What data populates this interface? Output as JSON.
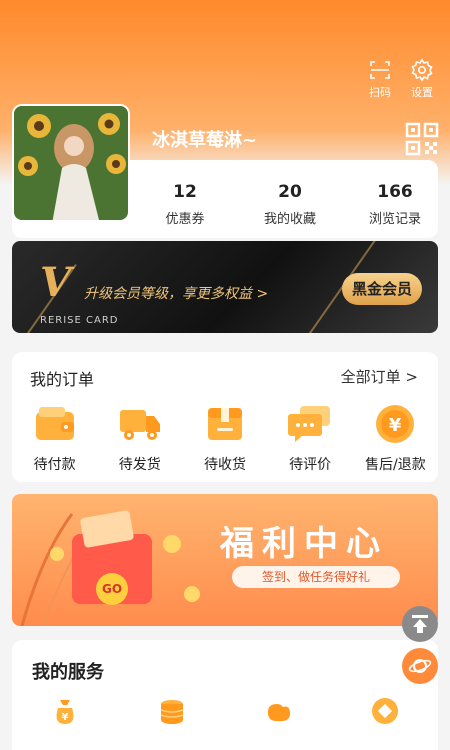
{
  "header": {
    "scan_label": "扫码",
    "settings_label": "设置"
  },
  "profile": {
    "username": "冰淇草莓淋~",
    "stats": [
      {
        "value": "12",
        "label": "优惠券"
      },
      {
        "value": "20",
        "label": "我的收藏"
      },
      {
        "value": "166",
        "label": "浏览记录"
      }
    ]
  },
  "vip": {
    "letter": "V",
    "text": "升级会员等级，享更多权益 >",
    "sub": "RERISE CARD",
    "button": "黑金会员"
  },
  "orders": {
    "title": "我的订单",
    "all_label": "全部订单 >",
    "items": [
      {
        "label": "待付款",
        "icon": "wallet-icon"
      },
      {
        "label": "待发货",
        "icon": "truck-icon"
      },
      {
        "label": "待收货",
        "icon": "box-icon"
      },
      {
        "label": "待评价",
        "icon": "comment-icon"
      },
      {
        "label": "售后/退款",
        "icon": "yuan-coin-icon"
      }
    ]
  },
  "welfare": {
    "title": "福利中心",
    "subtitle": "签到、做任务得好礼",
    "badge": "GO"
  },
  "services": {
    "title": "我的服务"
  },
  "colors": {
    "accent": "#ff8a2b",
    "gold": "#e6b15a"
  }
}
